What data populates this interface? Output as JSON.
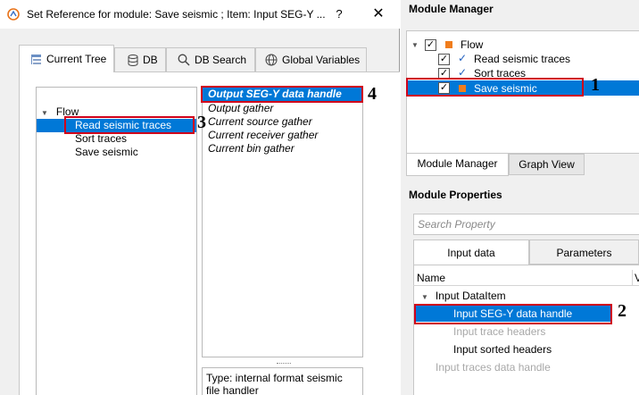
{
  "dialog": {
    "title": "Set Reference for module: Save seismic ; Item: Input SEG-Y ...",
    "help_label": "?",
    "close_label": "✕",
    "tabs": [
      {
        "label": "Current Tree",
        "icon": "tree-icon"
      },
      {
        "label": "DB",
        "icon": "database-icon"
      },
      {
        "label": "DB Search",
        "icon": "search-icon"
      },
      {
        "label": "Global Variables",
        "icon": "globe-icon"
      }
    ],
    "tree": {
      "root": "Flow",
      "items": [
        "Read seismic traces",
        "Sort traces",
        "Save seismic"
      ],
      "selected_index": 0
    },
    "list": {
      "items": [
        "Output SEG-Y data handle",
        "Output gather",
        "Current source gather",
        "Current receiver gather",
        "Current bin gather"
      ],
      "selected_index": 0
    },
    "description": "Type: internal format seismic file handler"
  },
  "module_manager": {
    "title": "Module Manager",
    "root": "Flow",
    "items": [
      "Read seismic traces",
      "Sort traces",
      "Save seismic"
    ],
    "check_mark": "✓",
    "selected_index": 2,
    "tabs": [
      "Module Manager",
      "Graph View"
    ]
  },
  "module_properties": {
    "title": "Module Properties",
    "search_placeholder": "Search Property",
    "tabs": [
      "Input data",
      "Parameters"
    ],
    "columns": [
      "Name",
      "V"
    ],
    "group": "Input DataItem",
    "rows": [
      "Input SEG-Y data handle",
      "Input trace headers",
      "Input sorted headers",
      "Input traces data handle"
    ]
  },
  "callouts": [
    "1",
    "2",
    "3",
    "4"
  ],
  "colors": {
    "selection": "#0078d7",
    "annotation": "#d0021b",
    "module_orange": "#f07d1c"
  }
}
